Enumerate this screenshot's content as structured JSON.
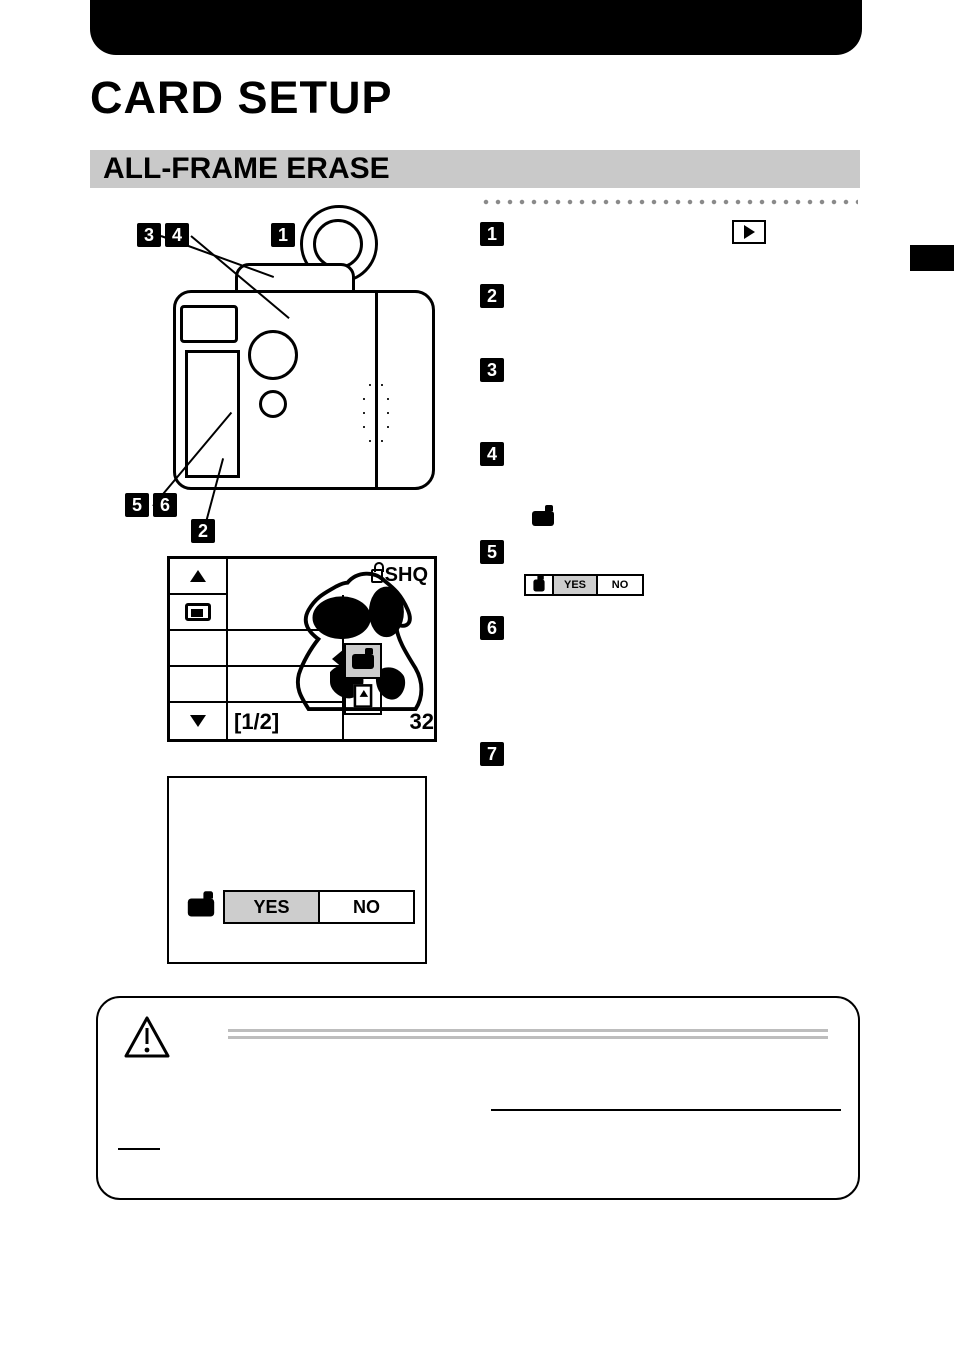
{
  "title": "CARD SETUP",
  "section_title": "ALL-FRAME ERASE",
  "camera_callouts": [
    "1",
    "2",
    "3",
    "4",
    "5",
    "6"
  ],
  "lcd_menu": {
    "top_right": "SHQ",
    "footer_left": "[1/2]",
    "footer_right": "32"
  },
  "confirm_large": {
    "yes": "YES",
    "no": "NO"
  },
  "confirm_small": {
    "yes": "YES",
    "no": "NO"
  },
  "steps": [
    {
      "num": "1",
      "extra": "play-icon"
    },
    {
      "num": "2"
    },
    {
      "num": "3",
      "spacer": 76
    },
    {
      "num": "4",
      "spacer": 76
    },
    {
      "num": "5",
      "extra": "cam-above-confirm"
    },
    {
      "num": "6",
      "spacer": 100
    },
    {
      "num": "7"
    }
  ]
}
